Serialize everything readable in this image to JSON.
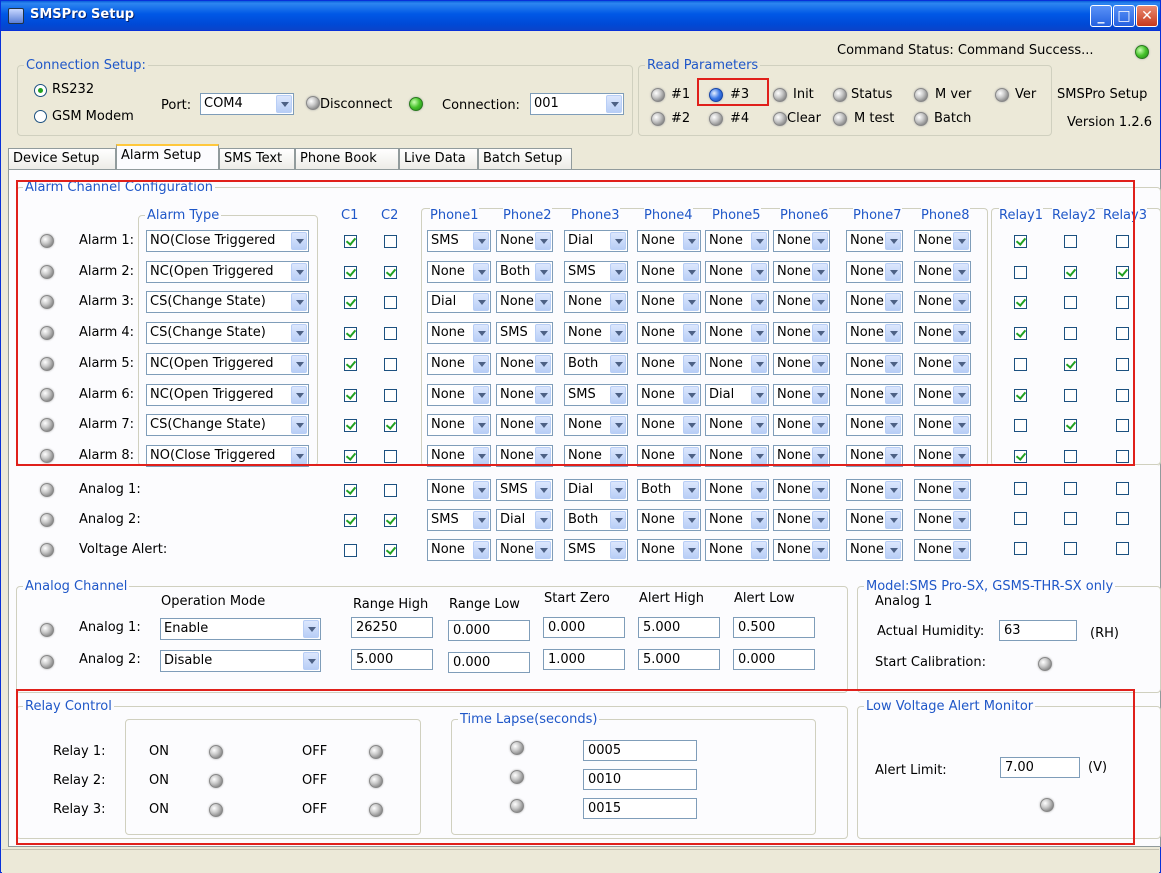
{
  "window": {
    "title": "SMSPro Setup"
  },
  "command_status": "Command Status:  Command Success...",
  "connection": {
    "legend": "Connection Setup:",
    "rs232": "RS232",
    "gsm": "GSM Modem",
    "port_label": "Port:",
    "port_value": "COM4",
    "disconnect": "Disconnect",
    "connection_label": "Connection:",
    "connection_value": "001"
  },
  "read_params": {
    "legend": "Read Parameters",
    "b1": "#1",
    "b3": "#3",
    "init": "Init",
    "status": "Status",
    "mver": "M ver",
    "ver": "Ver",
    "b2": "#2",
    "b4": "#4",
    "clear": "Clear",
    "mtest": "M test",
    "batch": "Batch"
  },
  "app_info": {
    "name": "SMSPro Setup",
    "version": "Version 1.2.6"
  },
  "tabs": [
    "Device Setup",
    "Alarm Setup",
    "SMS Text",
    "Phone Book",
    "Live Data",
    "Batch Setup"
  ],
  "alarm_config": {
    "legend": "Alarm Channel Configuration",
    "alarm_type_header": "Alarm Type",
    "c1": "C1",
    "c2": "C2",
    "phones": [
      "Phone1",
      "Phone2",
      "Phone3",
      "Phone4",
      "Phone5",
      "Phone6",
      "Phone7",
      "Phone8"
    ],
    "relays": [
      "Relay1",
      "Relay2",
      "Relay3"
    ],
    "alarms": [
      {
        "label": "Alarm 1:",
        "type": "NO(Close Triggered",
        "c1": true,
        "c2": false,
        "phones": [
          "SMS",
          "None",
          "Dial",
          "None",
          "None",
          "None",
          "None",
          "None"
        ],
        "relays": [
          true,
          false,
          false
        ]
      },
      {
        "label": "Alarm 2:",
        "type": "NC(Open Triggered",
        "c1": true,
        "c2": true,
        "phones": [
          "None",
          "Both",
          "SMS",
          "None",
          "None",
          "None",
          "None",
          "None"
        ],
        "relays": [
          false,
          true,
          true
        ]
      },
      {
        "label": "Alarm 3:",
        "type": "CS(Change State)",
        "c1": true,
        "c2": false,
        "phones": [
          "Dial",
          "None",
          "None",
          "None",
          "None",
          "None",
          "None",
          "None"
        ],
        "relays": [
          true,
          false,
          false
        ]
      },
      {
        "label": "Alarm 4:",
        "type": "CS(Change State)",
        "c1": true,
        "c2": false,
        "phones": [
          "None",
          "SMS",
          "None",
          "None",
          "None",
          "None",
          "None",
          "None"
        ],
        "relays": [
          true,
          false,
          false
        ]
      },
      {
        "label": "Alarm 5:",
        "type": "NC(Open Triggered",
        "c1": true,
        "c2": false,
        "phones": [
          "None",
          "None",
          "Both",
          "None",
          "None",
          "None",
          "None",
          "None"
        ],
        "relays": [
          false,
          true,
          false
        ]
      },
      {
        "label": "Alarm 6:",
        "type": "NC(Open Triggered",
        "c1": true,
        "c2": false,
        "phones": [
          "None",
          "None",
          "SMS",
          "None",
          "Dial",
          "None",
          "None",
          "None"
        ],
        "relays": [
          true,
          false,
          false
        ]
      },
      {
        "label": "Alarm 7:",
        "type": "CS(Change State)",
        "c1": true,
        "c2": true,
        "phones": [
          "None",
          "None",
          "None",
          "None",
          "None",
          "None",
          "None",
          "None"
        ],
        "relays": [
          false,
          true,
          false
        ]
      },
      {
        "label": "Alarm 8:",
        "type": "NO(Close Triggered",
        "c1": true,
        "c2": false,
        "phones": [
          "None",
          "None",
          "None",
          "None",
          "None",
          "None",
          "None",
          "None"
        ],
        "relays": [
          true,
          false,
          false
        ]
      }
    ],
    "extra": [
      {
        "label": "Analog 1:",
        "c1": true,
        "c2": false,
        "phones": [
          "None",
          "SMS",
          "Dial",
          "Both",
          "None",
          "None",
          "None",
          "None"
        ],
        "relays": [
          false,
          false,
          false
        ]
      },
      {
        "label": "Analog 2:",
        "c1": true,
        "c2": true,
        "phones": [
          "SMS",
          "Dial",
          "Both",
          "None",
          "None",
          "None",
          "None",
          "None"
        ],
        "relays": [
          false,
          false,
          false
        ]
      },
      {
        "label": "Voltage Alert:",
        "c1": false,
        "c2": true,
        "phones": [
          "None",
          "None",
          "SMS",
          "None",
          "None",
          "None",
          "None",
          "None"
        ],
        "relays": [
          false,
          false,
          false
        ]
      }
    ]
  },
  "analog_channel": {
    "legend": "Analog Channel",
    "headers": {
      "mode": "Operation Mode",
      "range_high": "Range High",
      "range_low": "Range Low",
      "start_zero": "Start Zero",
      "alert_high": "Alert High",
      "alert_low": "Alert Low"
    },
    "rows": [
      {
        "label": "Analog 1:",
        "mode": "Enable",
        "range_high": "26250",
        "range_low": "0.000",
        "start_zero": "0.000",
        "alert_high": "5.000",
        "alert_low": "0.500"
      },
      {
        "label": "Analog 2:",
        "mode": "Disable",
        "range_high": "5.000",
        "range_low": "0.000",
        "start_zero": "1.000",
        "alert_high": "5.000",
        "alert_low": "0.000"
      }
    ]
  },
  "model": {
    "legend": "Model:SMS Pro-SX, GSMS-THR-SX only",
    "analog": "Analog 1",
    "humidity_label": "Actual Humidity:",
    "humidity_value": "63",
    "humidity_unit": "(RH)",
    "calib_label": "Start Calibration:"
  },
  "relay_control": {
    "legend": "Relay Control",
    "on": "ON",
    "off": "OFF",
    "relays": [
      "Relay 1:",
      "Relay 2:",
      "Relay 3:"
    ],
    "time_legend": "Time Lapse(seconds)",
    "times": [
      "0005",
      "0010",
      "0015"
    ]
  },
  "low_voltage": {
    "legend": "Low Voltage Alert Monitor",
    "label": "Alert Limit:",
    "value": "7.00",
    "unit": "(V)"
  }
}
